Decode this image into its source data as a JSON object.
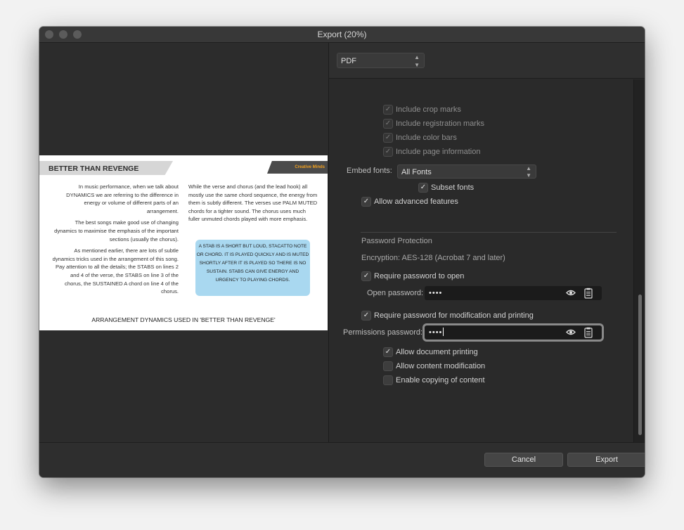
{
  "window": {
    "title": "Export (20%)"
  },
  "preview": {
    "heading": "BETTER THAN REVENGE",
    "logo": "Creative Minds",
    "left_paragraphs": [
      "In music performance, when we talk about DYNAMICS we are referring to the difference in energy or volume of different parts of an arrangement.",
      "The best songs make good use of changing dynamics to maximise the emphasis of the important sections (usually the chorus).",
      "As mentioned earlier, there are lots of subtle dynamics tricks used in the arrangement of this song. Pay attention to all the details; the STABS on lines 2 and 4 of the verse, the STABS on line 3 of the chorus, the SUSTAINED A chord on line 4 of the chorus."
    ],
    "right_paragraph": "While the verse and chorus (and the lead hook) all mostly use the same chord sequence, the energy from them is subtly different. The verses use PALM MUTED chords for a tighter sound. The chorus uses much fuller unmuted chords played with more emphasis.",
    "stab_box": "A STAB IS A SHORT BUT LOUD, STACATTO NOTE OR CHORD. IT IS PLAYED QUICKLY AND IS MUTED SHORTLY AFTER IT IS PLAYED SO THERE IS NO SUSTAIN. STABS CAN GIVE ENERGY AND URGENCY TO PLAYING CHORDS.",
    "footer": "ARRANGEMENT DYNAMICS USED IN 'BETTER THAN REVENGE'"
  },
  "settings": {
    "format": "PDF",
    "print_marks": [
      {
        "label": "Include crop marks",
        "checked": true
      },
      {
        "label": "Include registration marks",
        "checked": true
      },
      {
        "label": "Include color bars",
        "checked": true
      },
      {
        "label": "Include page information",
        "checked": true
      }
    ],
    "embed_fonts_label": "Embed fonts:",
    "embed_fonts_value": "All Fonts",
    "subset_fonts": {
      "label": "Subset fonts",
      "checked": true
    },
    "allow_advanced": {
      "label": "Allow advanced features",
      "checked": true
    },
    "password_section_title": "Password Protection",
    "encryption": "Encryption: AES-128 (Acrobat 7 and later)",
    "require_open": {
      "label": "Require password to open",
      "checked": true
    },
    "open_password_label": "Open password:",
    "open_password_value": "••••",
    "require_modify": {
      "label": "Require password for modification and printing",
      "checked": true
    },
    "permissions_password_label": "Permissions password:",
    "permissions_password_value": "••••",
    "allow_printing": {
      "label": "Allow document printing",
      "checked": true
    },
    "allow_modification": {
      "label": "Allow content modification",
      "checked": false
    },
    "allow_copying": {
      "label": "Enable copying of content",
      "checked": false
    }
  },
  "buttons": {
    "cancel": "Cancel",
    "export": "Export"
  },
  "icons": {
    "eye": "eye-icon",
    "clipboard": "clipboard-icon",
    "check": "checkmark-icon",
    "select_arrows": "updown-chevron-icon"
  }
}
